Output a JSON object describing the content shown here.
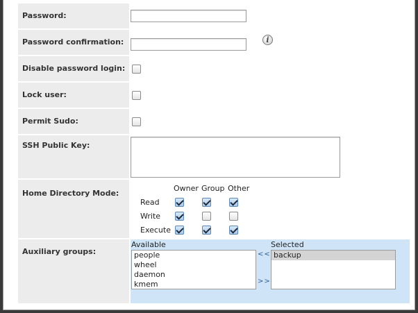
{
  "form": {
    "password": {
      "label": "Password:",
      "value": ""
    },
    "password_confirmation": {
      "label": "Password confirmation:",
      "value": "",
      "info_icon": "info-icon"
    },
    "disable_password_login": {
      "label": "Disable password login:",
      "checked": false
    },
    "lock_user": {
      "label": "Lock user:",
      "checked": false
    },
    "permit_sudo": {
      "label": "Permit Sudo:",
      "checked": false
    },
    "ssh_public_key": {
      "label": "SSH Public Key:",
      "value": ""
    },
    "home_directory_mode": {
      "label": "Home Directory Mode:",
      "columns": [
        "Owner",
        "Group",
        "Other"
      ],
      "rows": [
        {
          "label": "Read",
          "values": [
            true,
            true,
            true
          ]
        },
        {
          "label": "Write",
          "values": [
            true,
            false,
            false
          ]
        },
        {
          "label": "Execute",
          "values": [
            true,
            true,
            true
          ]
        }
      ]
    },
    "auxiliary_groups": {
      "label": "Auxiliary groups:",
      "available_label": "Available",
      "selected_label": "Selected",
      "available": [
        "people",
        "wheel",
        "daemon",
        "kmem"
      ],
      "selected": [
        "backup"
      ],
      "add_arrow": ">>",
      "remove_arrow": "<<"
    }
  }
}
